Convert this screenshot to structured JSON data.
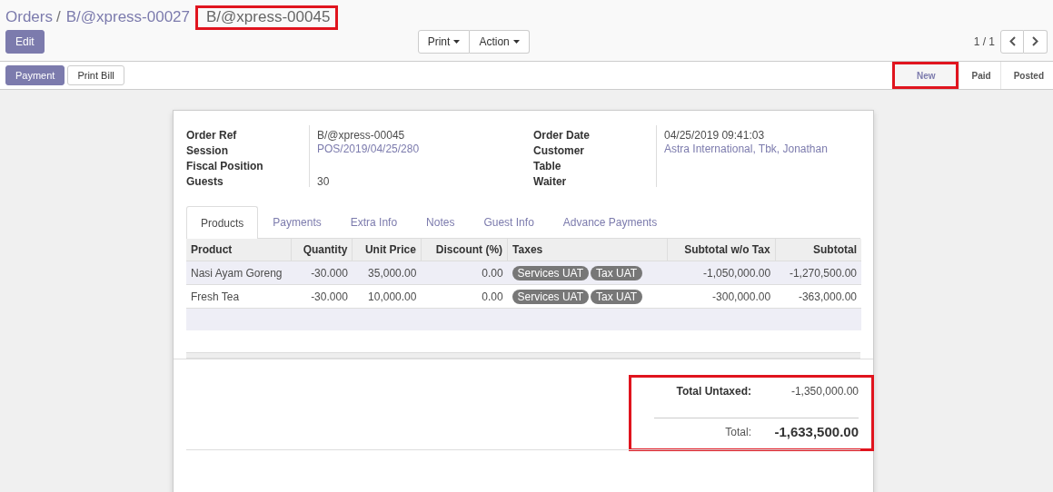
{
  "breadcrumbs": [
    {
      "label": "Orders",
      "highlighted": false
    },
    {
      "label": "B/@xpress-00027",
      "highlighted": false
    },
    {
      "label": "B/@xpress-00045",
      "highlighted": true
    }
  ],
  "breadcrumb_separator": "/",
  "edit_button": "Edit",
  "action_buttons": [
    "Print",
    "Action"
  ],
  "pager": "1 / 1",
  "header_buttons": [
    {
      "label": "Payment",
      "primary": true
    },
    {
      "label": "Print Bill",
      "primary": false
    }
  ],
  "stages": [
    {
      "label": "New",
      "selected": true,
      "highlighted": true
    },
    {
      "label": "Paid",
      "selected": false,
      "highlighted": false
    },
    {
      "label": "Posted",
      "selected": false,
      "highlighted": false
    }
  ],
  "fields_left": [
    {
      "label": "Order Ref",
      "value": "B/@xpress-00045",
      "link": false
    },
    {
      "label": "Session",
      "value": "POS/2019/04/25/280",
      "link": true
    },
    {
      "label": "Fiscal Position"
    },
    {
      "label": "Guests",
      "value": "30",
      "link": false
    }
  ],
  "fields_right": [
    {
      "label": "Order Date",
      "value": "04/25/2019 09:41:03",
      "link": false
    },
    {
      "label": "Customer",
      "value": "Astra International, Tbk, Jonathan",
      "link": true
    },
    {
      "label": "Table"
    },
    {
      "label": "Waiter"
    }
  ],
  "tabs": [
    {
      "label": "Products",
      "selected": true
    },
    {
      "label": "Payments",
      "selected": false
    },
    {
      "label": "Extra Info",
      "selected": false
    },
    {
      "label": "Notes",
      "selected": false
    },
    {
      "label": "Guest Info",
      "selected": false
    },
    {
      "label": "Advance Payments",
      "selected": false
    }
  ],
  "table": {
    "columns": [
      "Product",
      "Quantity",
      "Unit Price",
      "Discount (%)",
      "Taxes",
      "Subtotal w/o Tax",
      "Subtotal"
    ],
    "rows": [
      {
        "product": "Nasi Ayam Goreng",
        "quantity": "-30.000",
        "unit_price": "35,000.00",
        "discount": "0.00",
        "taxes": [
          "Services UAT",
          "Tax UAT"
        ],
        "subtotal_wo_tax": "-1,050,000.00",
        "subtotal": "-1,270,500.00",
        "selected": true
      },
      {
        "product": "Fresh Tea",
        "quantity": "-30.000",
        "unit_price": "10,000.00",
        "discount": "0.00",
        "taxes": [
          "Services UAT",
          "Tax UAT"
        ],
        "subtotal_wo_tax": "-300,000.00",
        "subtotal": "-363,000.00",
        "selected": false
      }
    ]
  },
  "totals": {
    "highlighted": true,
    "untaxed_label": "Total Untaxed:",
    "untaxed_value": "-1,350,000.00",
    "total_label": "Total:",
    "total_value": "-1,633,500.00"
  }
}
